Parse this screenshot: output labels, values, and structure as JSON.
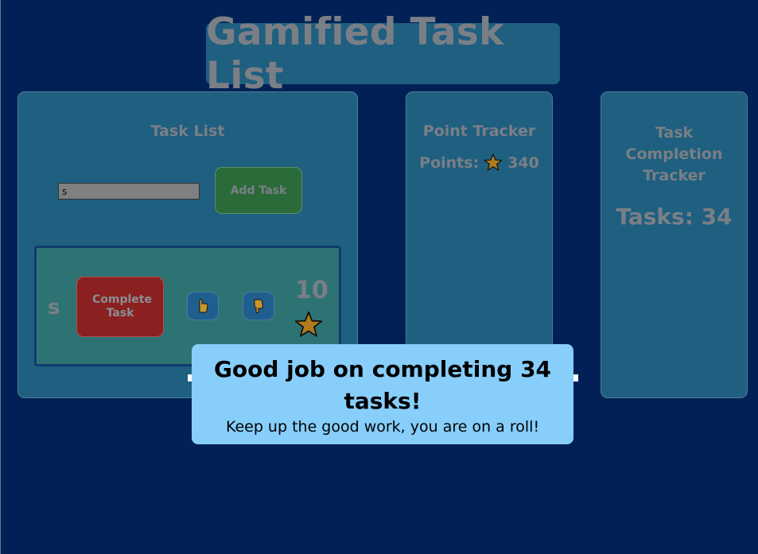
{
  "app": {
    "title": "Gamified Task List"
  },
  "task_list": {
    "heading": "Task List",
    "input_value": "s",
    "add_button_label": "Add Task",
    "items": [
      {
        "name": "s",
        "complete_label": "Complete Task",
        "points": "10"
      }
    ]
  },
  "point_tracker": {
    "heading": "Point Tracker",
    "label": "Points:",
    "value": "340"
  },
  "completion_tracker": {
    "heading": "Task Completion Tracker",
    "label": "Tasks: 34"
  },
  "notification": {
    "title": "Good job on completing 34 tasks!",
    "message": "Keep up the good work, you are on a roll!"
  },
  "colors": {
    "background": "#012156",
    "panel": "#1f5f80",
    "add": "#2b6b3a",
    "complete": "#8b2020",
    "notification": "#87cefa",
    "star": "#b07d1a"
  },
  "icons": [
    "star-icon",
    "thumbs-up-icon",
    "thumbs-down-icon"
  ]
}
